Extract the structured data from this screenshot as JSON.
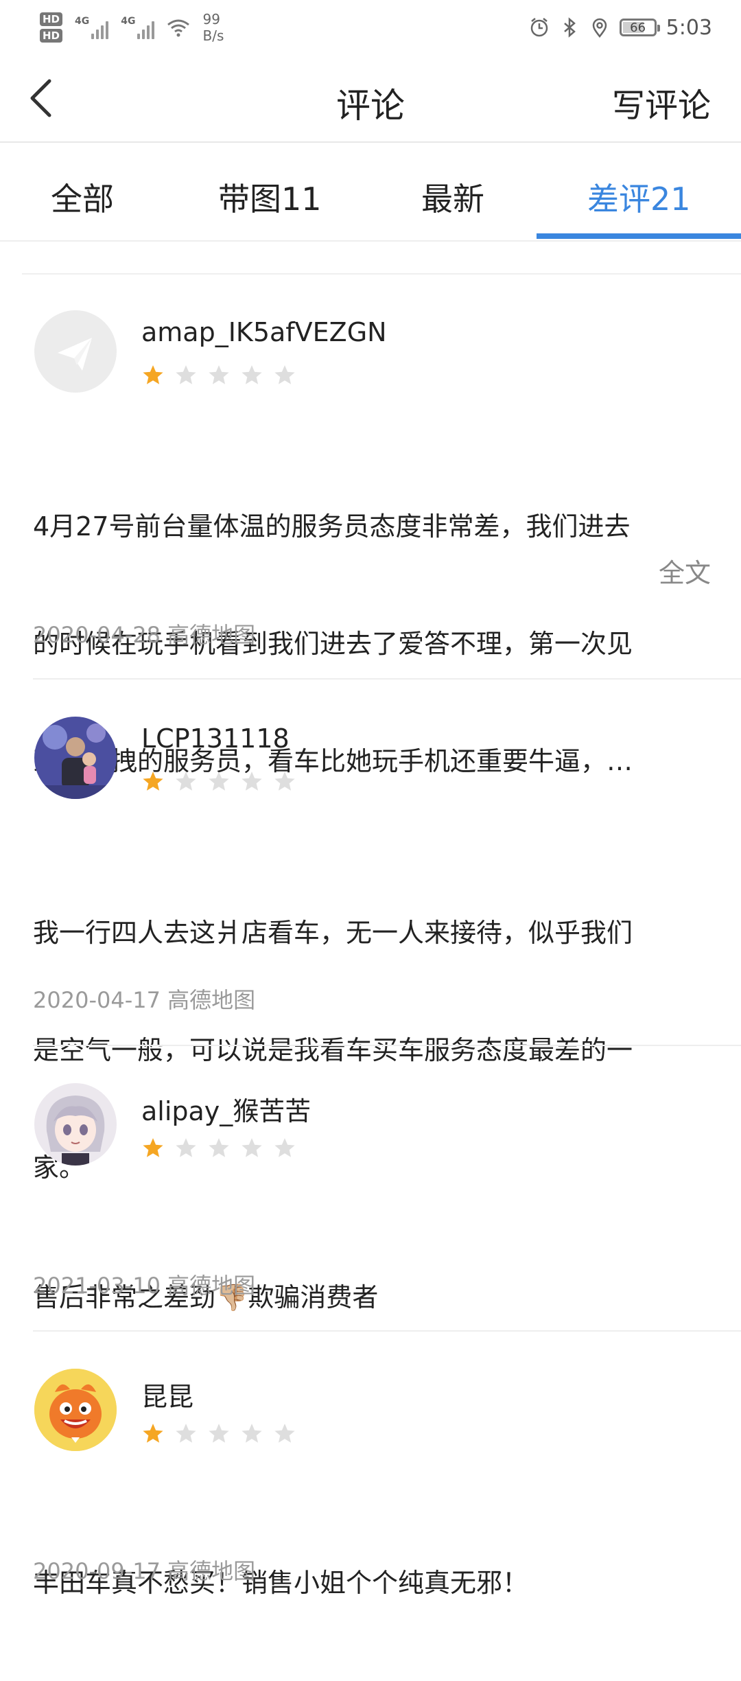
{
  "status_bar": {
    "hd1": "HD",
    "hd2": "HD",
    "signal1": "4G",
    "signal2": "4G",
    "speed_value": "99",
    "speed_unit": "B/s",
    "battery": "66",
    "time": "5:03",
    "icons": [
      "alarm-icon",
      "bluetooth-icon",
      "location-icon",
      "battery-icon",
      "wifi-icon"
    ]
  },
  "nav": {
    "title": "评论",
    "write": "写评论"
  },
  "tabs": [
    {
      "label": "全部",
      "active": false
    },
    {
      "label": "带图11",
      "active": false
    },
    {
      "label": "最新",
      "active": false
    },
    {
      "label": "差评21",
      "active": true
    }
  ],
  "accent_color": "#3a86df",
  "star_color": "#f5a623",
  "reviews": [
    {
      "username": "amap_IK5afVEZGN",
      "rating": 1,
      "lines": [
        "4月27号前台量体温的服务员态度非常差，我们进去",
        "的时候在玩手机看到我们进去了爱答不理，第一次见",
        "到这么拽的服务员，看车比她玩手机还重要牛逼，…"
      ],
      "full_text_label": "全文",
      "date": "2020-04-28",
      "source": "高德地图"
    },
    {
      "username": "LCP131118",
      "rating": 1,
      "lines": [
        "我一行四人去这爿店看车，无一人来接待，似乎我们",
        "是空气一般，可以说是我看车买车服务态度最差的一",
        "家。"
      ],
      "date": "2020-04-17",
      "source": "高德地图"
    },
    {
      "username": "alipay_猴苦苦",
      "rating": 1,
      "lines": [
        "售后非常之差劲👎🏼欺骗消费者"
      ],
      "date": "2021-03-10",
      "source": "高德地图"
    },
    {
      "username": "昆昆",
      "rating": 1,
      "lines": [
        "丰田车真不愁买！销售小姐个个纯真无邪！"
      ],
      "date": "2020-09-17",
      "source": "高德地图"
    }
  ]
}
